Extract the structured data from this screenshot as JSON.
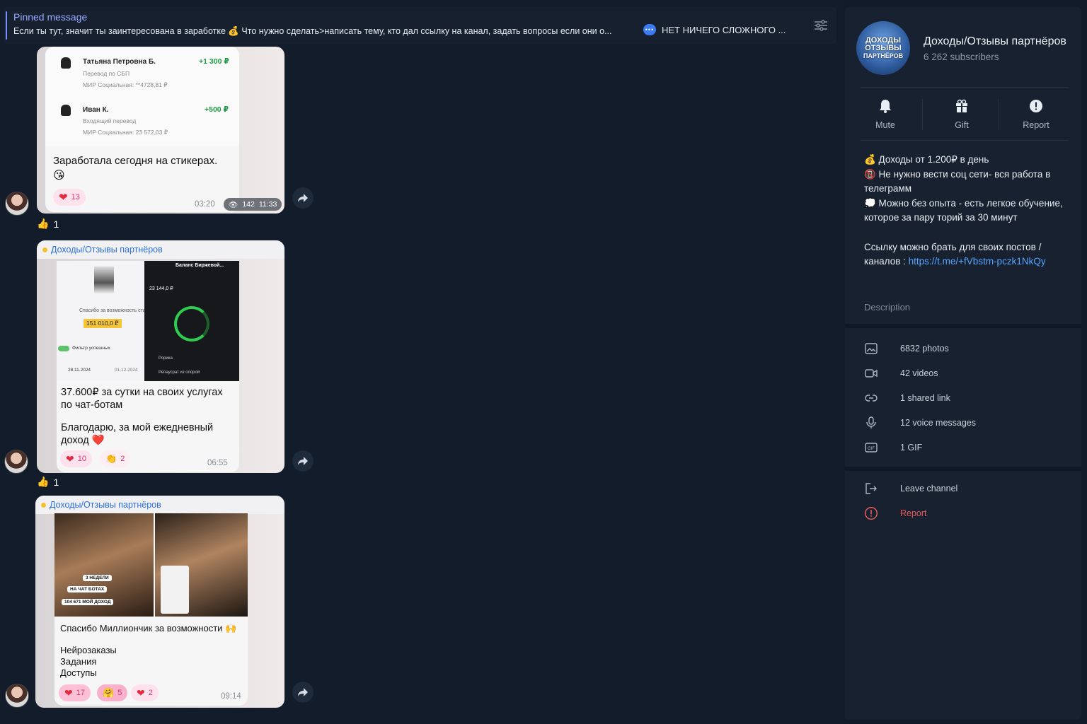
{
  "pinned": {
    "title": "Pinned message",
    "text": "Если ты тут, значит ты заинтересована в заработке 💰 Что нужно сделать>написать тему, кто дал ссылку на канал, задать вопросы если они о...",
    "text2": "НЕТ НИЧЕГО СЛОЖНОГО ..."
  },
  "messages": [
    {
      "receipt": [
        {
          "name": "Татьяна Петровна Б.",
          "type": "Перевод по СБП",
          "card": "МИР Социальная: **4728,81 ₽",
          "amount": "+1 300 ₽"
        },
        {
          "name": "Иван К.",
          "type": "Входящий перевод",
          "card": "МИР Социальная: 23 572,03 ₽",
          "amount": "+500 ₽"
        }
      ],
      "caption": "Заработала сегодня на стикерах.",
      "caption_emoji": "😘",
      "reaction_count": "13",
      "time": "03:20",
      "views": "142",
      "views_time": "11:33",
      "thumb_count": "1"
    },
    {
      "source": "Доходы/Отзывы партнёров",
      "img_left_text": "Спасибо за возможность стать",
      "img_left_amount": "151 010,0 ₽",
      "img_left_filter": "Фильтр успешных",
      "img_left_date1": "28.11.2024",
      "img_left_date2": "01.12.2024",
      "img_right_title": "Баланс Биржевой...",
      "img_right_value": "23 144,0 ₽",
      "img_right_row1": "Рорика",
      "img_right_row2": "Репаусрат из опорой",
      "caption1": "37.600₽ за сутки на своих услугах по чат-ботам",
      "caption2": "Благодарю, за мой ежедневный доход",
      "caption2_emoji": "❤️",
      "r1": "10",
      "r2": "2",
      "time": "06:55",
      "thumb_count": "1"
    },
    {
      "source": "Доходы/Отзывы партнёров",
      "stickers": [
        "3 НЕДЕЛИ",
        "НА ЧАТ БОТАХ",
        "104 671 МОЙ ДОХОД"
      ],
      "caption1": "Спасибо Миллиончик за возможности",
      "caption1_emoji": "🙌",
      "lines": [
        "Нейрозаказы",
        "Задания",
        "Доступы"
      ],
      "r1": "17",
      "r2": "5",
      "r3": "2",
      "time": "09:14"
    }
  ],
  "panel": {
    "logo_lines": [
      "ДОХОДЫ",
      "ОТЗЫВЫ",
      "ПАРТНЁРОВ"
    ],
    "title": "Доходы/Отзывы партнёров",
    "subscribers": "6 262 subscribers",
    "actions": {
      "mute": "Mute",
      "gift": "Gift",
      "report": "Report"
    },
    "description": {
      "l1": "💰 Доходы от 1.200₽ в день",
      "l2": "📵 Не нужно вести соц сети- вся работа в телеграмм",
      "l3": "💭 Можно без опыта - есть легкое обучение, которое за пару торий за 30 минут",
      "l4_prefix": "Ссылку можно брать для своих постов /каналов : ",
      "link": "https://t.me/+fVbstm-pczk1NkQy"
    },
    "desc_label": "Description",
    "stats": {
      "photos": "6832 photos",
      "videos": "42 videos",
      "links": "1 shared link",
      "voice": "12 voice messages",
      "gif": "1 GIF"
    },
    "leave": "Leave channel",
    "report": "Report"
  },
  "colors": {
    "accent": "#5aa5ff",
    "danger": "#e85a5a",
    "bg": "#121c2b",
    "panel": "#172130"
  }
}
